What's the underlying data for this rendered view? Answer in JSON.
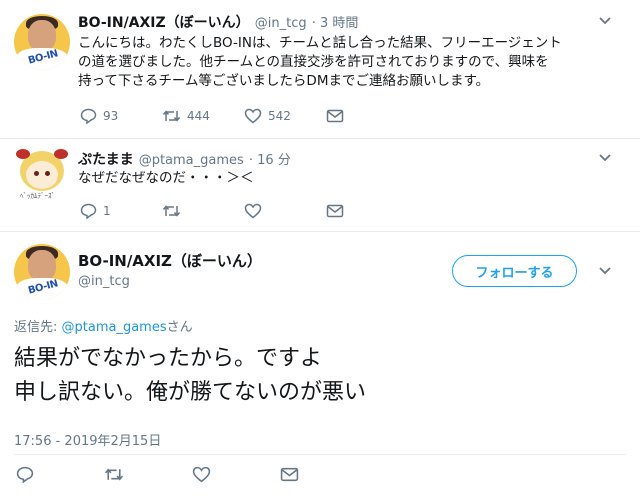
{
  "tweet1": {
    "display_name": "BO-IN/AXIZ（ぼーいん）",
    "handle": "@in_tcg",
    "time": "· 3 時間",
    "avatar_text": "BO-IN",
    "lines": [
      "こんにちは。わたくしBO-INは、チームと話し合った結果、フリーエージェント",
      "の道を選びました。他チームとの直接交渉を許可されておりますので、興味を",
      "持って下さるチーム等ございましたらDMまでご連絡お願いします。"
    ],
    "reply_count": "93",
    "retweet_count": "444",
    "like_count": "542"
  },
  "tweet2": {
    "display_name": "ぷたまま",
    "handle": "@ptama_games",
    "time": "· 16 分",
    "avatar_caption": "ﾍﾞｯｶﾑﾃﾞｰｽﾞ",
    "text": "なぜだなぜなのだ・・・＞＜",
    "reply_count": "1"
  },
  "main_tweet": {
    "display_name": "BO-IN/AXIZ（ぼーいん）",
    "handle": "@in_tcg",
    "avatar_text": "BO-IN",
    "follow_label": "フォローする",
    "reply_prefix": "返信先: ",
    "reply_to": "@ptama_games",
    "reply_suffix": "さん",
    "lines": [
      "結果がでなかったから。ですよ",
      "申し訳ない。俺が勝てないのが悪い"
    ],
    "timestamp": "17:56 - 2019年2月15日"
  },
  "colors": {
    "accent": "#1da1f2",
    "link": "#1b95e0",
    "secondary_text": "#657786",
    "divider": "#e6ecf0"
  }
}
